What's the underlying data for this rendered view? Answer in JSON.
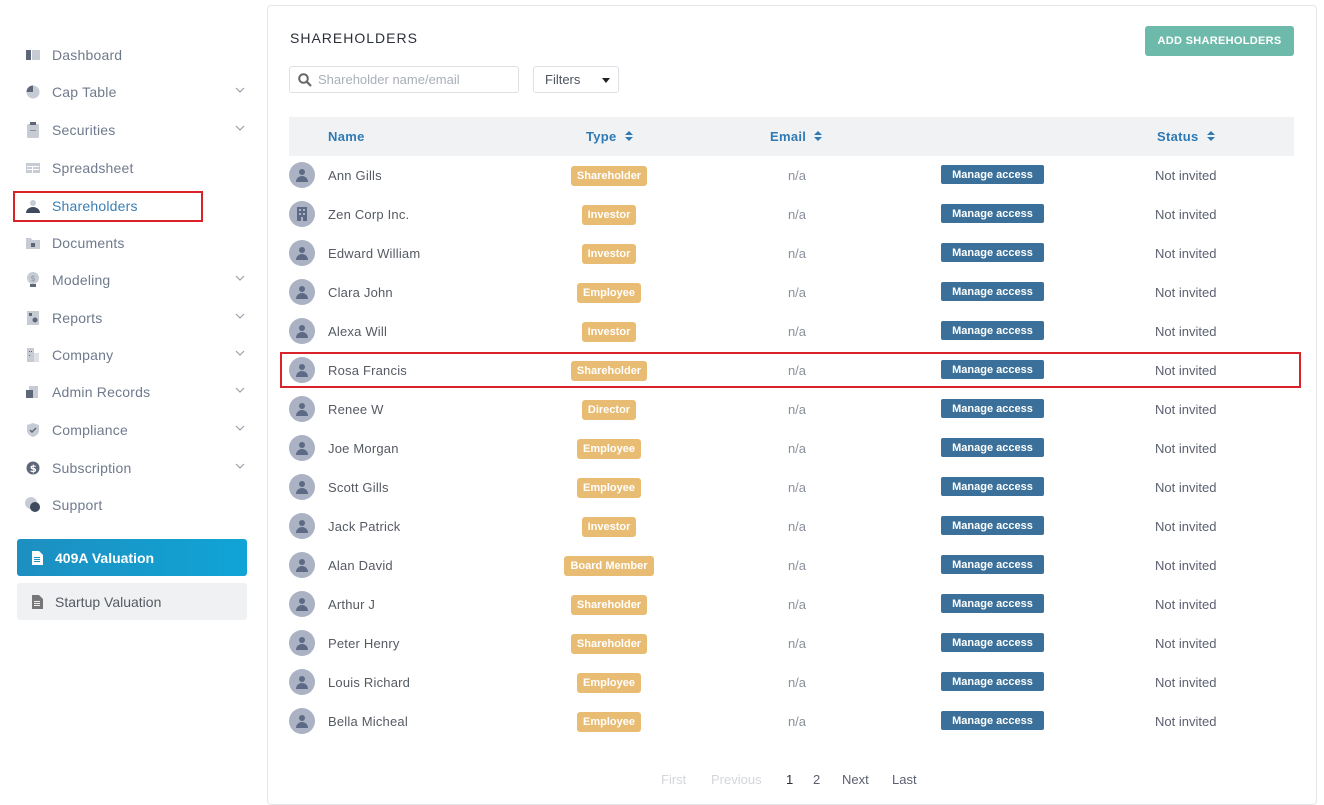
{
  "sidebar": {
    "items": [
      {
        "label": "Dashboard",
        "icon": "dashboard-icon",
        "expandable": false
      },
      {
        "label": "Cap Table",
        "icon": "pie-chart-icon",
        "expandable": true
      },
      {
        "label": "Securities",
        "icon": "clipboard-icon",
        "expandable": true
      },
      {
        "label": "Spreadsheet",
        "icon": "table-icon",
        "expandable": false
      },
      {
        "label": "Shareholders",
        "icon": "user-icon",
        "expandable": false,
        "active": true
      },
      {
        "label": "Documents",
        "icon": "folder-lock-icon",
        "expandable": false
      },
      {
        "label": "Modeling",
        "icon": "lightbulb-dollar-icon",
        "expandable": true
      },
      {
        "label": "Reports",
        "icon": "report-icon",
        "expandable": true
      },
      {
        "label": "Company",
        "icon": "building-icon",
        "expandable": true
      },
      {
        "label": "Admin Records",
        "icon": "admin-records-icon",
        "expandable": true
      },
      {
        "label": "Compliance",
        "icon": "shield-check-icon",
        "expandable": true
      },
      {
        "label": "Subscription",
        "icon": "dollar-circle-icon",
        "expandable": true
      },
      {
        "label": "Support",
        "icon": "support-icon",
        "expandable": false
      }
    ],
    "valuation_409a": "409A Valuation",
    "startup_valuation": "Startup Valuation"
  },
  "main": {
    "title": "SHAREHOLDERS",
    "add_button": "ADD SHAREHOLDERS",
    "search_placeholder": "Shareholder name/email",
    "filters_label": "Filters",
    "columns": {
      "name": "Name",
      "type": "Type",
      "email": "Email",
      "status": "Status"
    },
    "rows": [
      {
        "name": "Ann Gills",
        "type": "Shareholder",
        "email": "n/a",
        "action": "Manage access",
        "status": "Not invited",
        "avatar": "person"
      },
      {
        "name": "Zen Corp Inc.",
        "type": "Investor",
        "email": "n/a",
        "action": "Manage access",
        "status": "Not invited",
        "avatar": "building"
      },
      {
        "name": "Edward William",
        "type": "Investor",
        "email": "n/a",
        "action": "Manage access",
        "status": "Not invited",
        "avatar": "person"
      },
      {
        "name": "Clara John",
        "type": "Employee",
        "email": "n/a",
        "action": "Manage access",
        "status": "Not invited",
        "avatar": "person"
      },
      {
        "name": "Alexa Will",
        "type": "Investor",
        "email": "n/a",
        "action": "Manage access",
        "status": "Not invited",
        "avatar": "person"
      },
      {
        "name": "Rosa Francis",
        "type": "Shareholder",
        "email": "n/a",
        "action": "Manage access",
        "status": "Not invited",
        "avatar": "person",
        "highlighted": true
      },
      {
        "name": "Renee W",
        "type": "Director",
        "email": "n/a",
        "action": "Manage access",
        "status": "Not invited",
        "avatar": "person"
      },
      {
        "name": "Joe Morgan",
        "type": "Employee",
        "email": "n/a",
        "action": "Manage access",
        "status": "Not invited",
        "avatar": "person"
      },
      {
        "name": "Scott Gills",
        "type": "Employee",
        "email": "n/a",
        "action": "Manage access",
        "status": "Not invited",
        "avatar": "person"
      },
      {
        "name": "Jack Patrick",
        "type": "Investor",
        "email": "n/a",
        "action": "Manage access",
        "status": "Not invited",
        "avatar": "person"
      },
      {
        "name": "Alan David",
        "type": "Board Member",
        "email": "n/a",
        "action": "Manage access",
        "status": "Not invited",
        "avatar": "person"
      },
      {
        "name": "Arthur J",
        "type": "Shareholder",
        "email": "n/a",
        "action": "Manage access",
        "status": "Not invited",
        "avatar": "person"
      },
      {
        "name": "Peter Henry",
        "type": "Shareholder",
        "email": "n/a",
        "action": "Manage access",
        "status": "Not invited",
        "avatar": "person"
      },
      {
        "name": "Louis Richard",
        "type": "Employee",
        "email": "n/a",
        "action": "Manage access",
        "status": "Not invited",
        "avatar": "person"
      },
      {
        "name": "Bella Micheal",
        "type": "Employee",
        "email": "n/a",
        "action": "Manage access",
        "status": "Not invited",
        "avatar": "person"
      }
    ],
    "pagination": {
      "first": "First",
      "previous": "Previous",
      "pages": [
        "1",
        "2"
      ],
      "current": "1",
      "next": "Next",
      "last": "Last"
    }
  },
  "colors": {
    "accent_blue": "#2f7ab4",
    "badge_orange": "#e9bc74",
    "manage_button": "#3a7099",
    "add_button": "#6dbaaa",
    "valuation_button": "#10a4d6",
    "highlight_red": "#d9222a"
  }
}
